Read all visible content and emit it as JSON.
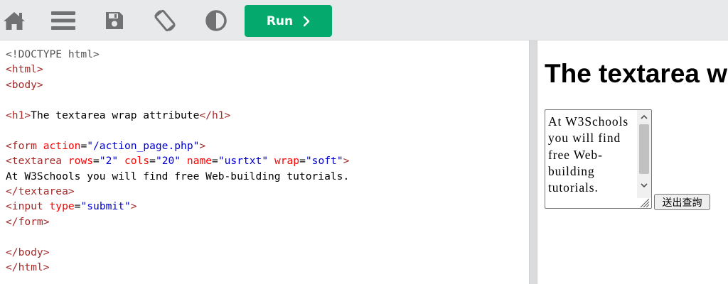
{
  "toolbar": {
    "icons": [
      "home-icon",
      "menu-icon",
      "save-icon",
      "rotate-icon",
      "contrast-icon"
    ],
    "run_label": "Run",
    "icon_color": "#6f7173",
    "run_color": "#04aa6d"
  },
  "editor": {
    "lines": [
      [
        {
          "t": "<!DOCTYPE html>",
          "c": "dt"
        }
      ],
      [
        {
          "t": "<html>",
          "c": "tag"
        }
      ],
      [
        {
          "t": "<body>",
          "c": "tag"
        }
      ],
      [],
      [
        {
          "t": "<h1>",
          "c": "tag"
        },
        {
          "t": "The textarea wrap attribute",
          "c": "plain"
        },
        {
          "t": "</h1>",
          "c": "tag"
        }
      ],
      [],
      [
        {
          "t": "<form ",
          "c": "tag"
        },
        {
          "t": "action",
          "c": "attr"
        },
        {
          "t": "=",
          "c": "plain"
        },
        {
          "t": "\"/action_page.php\"",
          "c": "val"
        },
        {
          "t": ">",
          "c": "tag"
        }
      ],
      [
        {
          "t": "<textarea ",
          "c": "tag"
        },
        {
          "t": "rows",
          "c": "attr"
        },
        {
          "t": "=",
          "c": "plain"
        },
        {
          "t": "\"2\"",
          "c": "val"
        },
        {
          "t": " ",
          "c": "plain"
        },
        {
          "t": "cols",
          "c": "attr"
        },
        {
          "t": "=",
          "c": "plain"
        },
        {
          "t": "\"20\"",
          "c": "val"
        },
        {
          "t": " ",
          "c": "plain"
        },
        {
          "t": "name",
          "c": "attr"
        },
        {
          "t": "=",
          "c": "plain"
        },
        {
          "t": "\"usrtxt\"",
          "c": "val"
        },
        {
          "t": " ",
          "c": "plain"
        },
        {
          "t": "wrap",
          "c": "attr"
        },
        {
          "t": "=",
          "c": "plain"
        },
        {
          "t": "\"soft\"",
          "c": "val"
        },
        {
          "t": ">",
          "c": "tag"
        }
      ],
      [
        {
          "t": "At W3Schools you will find free Web-building tutorials.",
          "c": "plain"
        }
      ],
      [
        {
          "t": "</textarea>",
          "c": "tag"
        }
      ],
      [
        {
          "t": "<input ",
          "c": "tag"
        },
        {
          "t": "type",
          "c": "attr"
        },
        {
          "t": "=",
          "c": "plain"
        },
        {
          "t": "\"submit\"",
          "c": "val"
        },
        {
          "t": ">",
          "c": "tag"
        }
      ],
      [
        {
          "t": "</form>",
          "c": "tag"
        }
      ],
      [],
      [
        {
          "t": "</body>",
          "c": "tag"
        }
      ],
      [
        {
          "t": "</html>",
          "c": "tag"
        }
      ]
    ]
  },
  "preview": {
    "heading": "The textarea wrap attribute",
    "textarea_value": "At W3Schools you will find free Web-building tutorials.",
    "submit_label": "送出查詢"
  }
}
